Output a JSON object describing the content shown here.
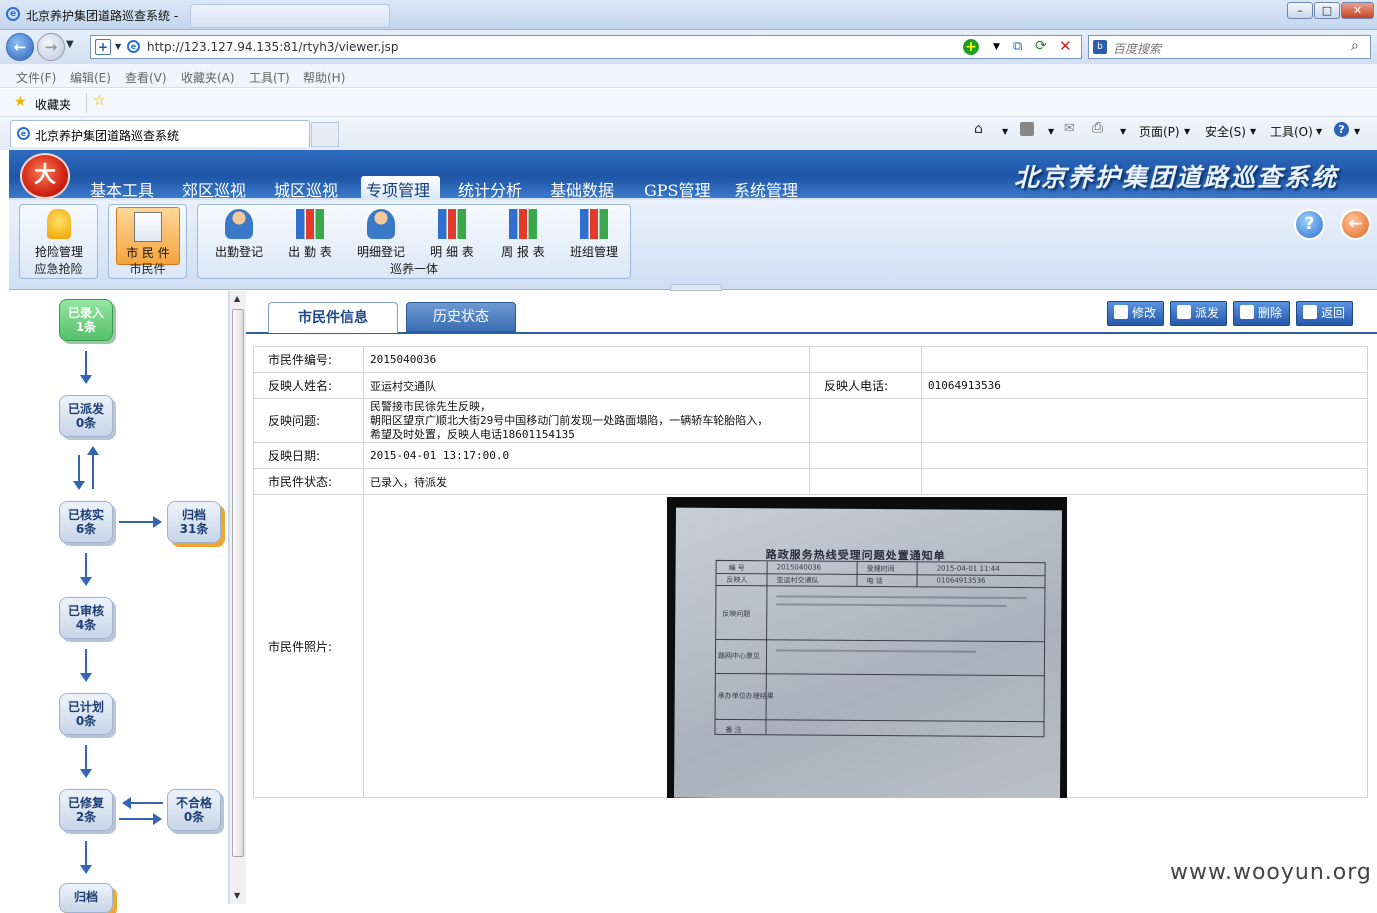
{
  "browser": {
    "window_title": "北京养护集团道路巡查系统 -",
    "url": "http://123.127.94.135:81/rtyh3/viewer.jsp",
    "search_placeholder": "百度搜索",
    "menus": [
      "文件(F)",
      "编辑(E)",
      "查看(V)",
      "收藏夹(A)",
      "工具(T)",
      "帮助(H)"
    ],
    "favorites_label": "收藏夹",
    "tab_title": "北京养护集团道路巡查系统",
    "commands": {
      "page": "页面(P)",
      "safety": "安全(S)",
      "tools": "工具(O)"
    }
  },
  "app": {
    "title": "北京养护集团道路巡查系统",
    "logo_text": "大",
    "nav": [
      "基本工具",
      "郊区巡视",
      "城区巡视",
      "专项管理",
      "统计分析",
      "基础数据",
      "GPS管理",
      "系统管理"
    ],
    "nav_active": "专项管理",
    "toolbar": {
      "group1": {
        "label": "应急抢险",
        "buttons": [
          "抢险管理"
        ]
      },
      "group2": {
        "label": "市民件",
        "buttons": [
          "市 民 件"
        ]
      },
      "group3": {
        "label": "巡养一体",
        "buttons": [
          "出勤登记",
          "出 勤 表",
          "明细登记",
          "明 细 表",
          "周 报 表",
          "班组管理"
        ]
      }
    },
    "help_icon": "?"
  },
  "flow": {
    "recorded": [
      "已录入",
      "1条"
    ],
    "dispatched": [
      "已派发",
      "0条"
    ],
    "verified": [
      "已核实",
      "6条"
    ],
    "archived_side": [
      "归档",
      "31条"
    ],
    "reviewed": [
      "已审核",
      "4条"
    ],
    "planned": [
      "已计划",
      "0条"
    ],
    "repaired": [
      "已修复",
      "2条"
    ],
    "unqualified": [
      "不合格",
      "0条"
    ],
    "archived_bottom": [
      "归档"
    ]
  },
  "content": {
    "tabs": [
      "市民件信息",
      "历史状态"
    ],
    "actions": [
      "修改",
      "派发",
      "删除",
      "返回"
    ],
    "fields": {
      "id_label": "市民件编号:",
      "id_value": "2015040036",
      "name_label": "反映人姓名:",
      "name_value": "亚运村交通队",
      "phone_label": "反映人电话:",
      "phone_value": "01064913536",
      "issue_label": "反映问题:",
      "issue_lines": [
        "民警接市民徐先生反映，",
        "朝阳区望京广顺北大街29号中国移动门前发现一处路面塌陷，一辆轿车轮胎陷入，",
        "希望及时处置，反映人电话18601154135"
      ],
      "date_label": "反映日期:",
      "date_value": "2015-04-01 13:17:00.0",
      "status_label": "市民件状态:",
      "status_value": "已录入，待派发",
      "photo_label": "市民件照片:"
    },
    "photo": {
      "doc_title": "路政服务热线受理问题处置通知单",
      "rows": [
        "编 号",
        "反映人",
        "反映问题",
        "路网中心意见",
        "承办单位办理结果",
        "备 注"
      ],
      "cells": [
        "2015040036",
        "受理时间",
        "2015-04-01 11:44",
        "亚运村交通队",
        "电 话",
        "01064913536"
      ]
    }
  },
  "watermark": "www.wooyun.org"
}
